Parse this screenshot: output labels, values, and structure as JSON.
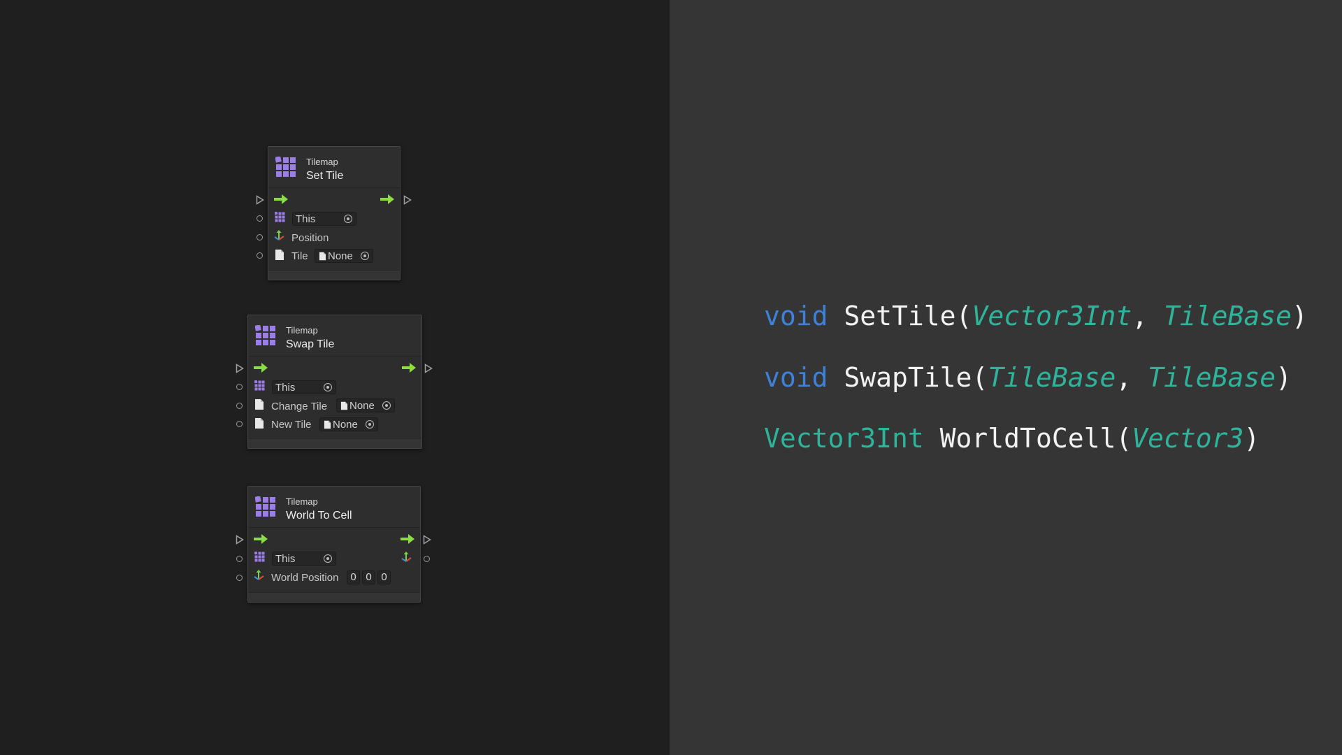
{
  "colors": {
    "left_background": "#1f1f1f",
    "right_background": "#363536",
    "flow_arrow": "#8bdd44",
    "tilemap_icon": "#9c7ee8",
    "keyword": "#3d82d8",
    "type": "#2eb49b",
    "identifier": "#f2f2f2"
  },
  "nodes": [
    {
      "category": "Tilemap",
      "title": "Set Tile",
      "icon": "tilemap-grid-icon",
      "inputs": [
        {
          "label": "This",
          "icon": "tilemap-grid-icon"
        },
        {
          "label": "Position",
          "icon": "vector-axes-icon"
        },
        {
          "label": "Tile",
          "icon": "document-icon",
          "value": "None"
        }
      ]
    },
    {
      "category": "Tilemap",
      "title": "Swap Tile",
      "icon": "tilemap-grid-icon",
      "inputs": [
        {
          "label": "This",
          "icon": "tilemap-grid-icon"
        },
        {
          "label": "Change Tile",
          "icon": "document-icon",
          "value": "None"
        },
        {
          "label": "New Tile",
          "icon": "document-icon",
          "value": "None"
        }
      ]
    },
    {
      "category": "Tilemap",
      "title": "World To Cell",
      "icon": "tilemap-grid-icon",
      "inputs": [
        {
          "label": "This",
          "icon": "tilemap-grid-icon"
        },
        {
          "label": "World Position",
          "icon": "vector-axes-icon",
          "values": [
            "0",
            "0",
            "0"
          ]
        }
      ],
      "output_icon": "vector-axes-icon"
    }
  ],
  "code": [
    {
      "ret": "void",
      "name": "SetTile",
      "open": "(",
      "params": [
        "Vector3Int",
        "TileBase"
      ],
      "sep": ", ",
      "close": ")"
    },
    {
      "ret": "void",
      "name": "SwapTile",
      "open": "(",
      "params": [
        "TileBase",
        "TileBase"
      ],
      "sep": ", ",
      "close": ")"
    },
    {
      "ret": "Vector3Int",
      "name": "WorldToCell",
      "open": "(",
      "params": [
        "Vector3"
      ],
      "sep": "",
      "close": ")"
    }
  ]
}
